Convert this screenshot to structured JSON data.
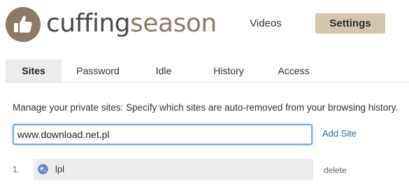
{
  "header": {
    "brand_part1": "cuffing",
    "brand_part2": "season",
    "nav": {
      "videos_label": "Videos",
      "settings_label": "Settings"
    }
  },
  "tabs": [
    {
      "label": "Sites",
      "active": true
    },
    {
      "label": "Password",
      "active": false
    },
    {
      "label": "Idle",
      "active": false
    },
    {
      "label": "History",
      "active": false
    },
    {
      "label": "Access",
      "active": false
    }
  ],
  "main": {
    "description": "Manage your private sites: Specify which sites are auto-removed from your browsing history.",
    "site_input_value": "www.download.net.pl",
    "add_site_label": "Add Site",
    "sites": [
      {
        "index": "1.",
        "label": "lpl",
        "delete_label": "delete",
        "icon": "globe-icon"
      }
    ]
  },
  "colors": {
    "accent": "#d4c5af",
    "brand_dark": "#4a4a4a",
    "brand_light": "#8b7b69",
    "link": "#2a6f8e",
    "input_focus": "#76a8dd"
  }
}
